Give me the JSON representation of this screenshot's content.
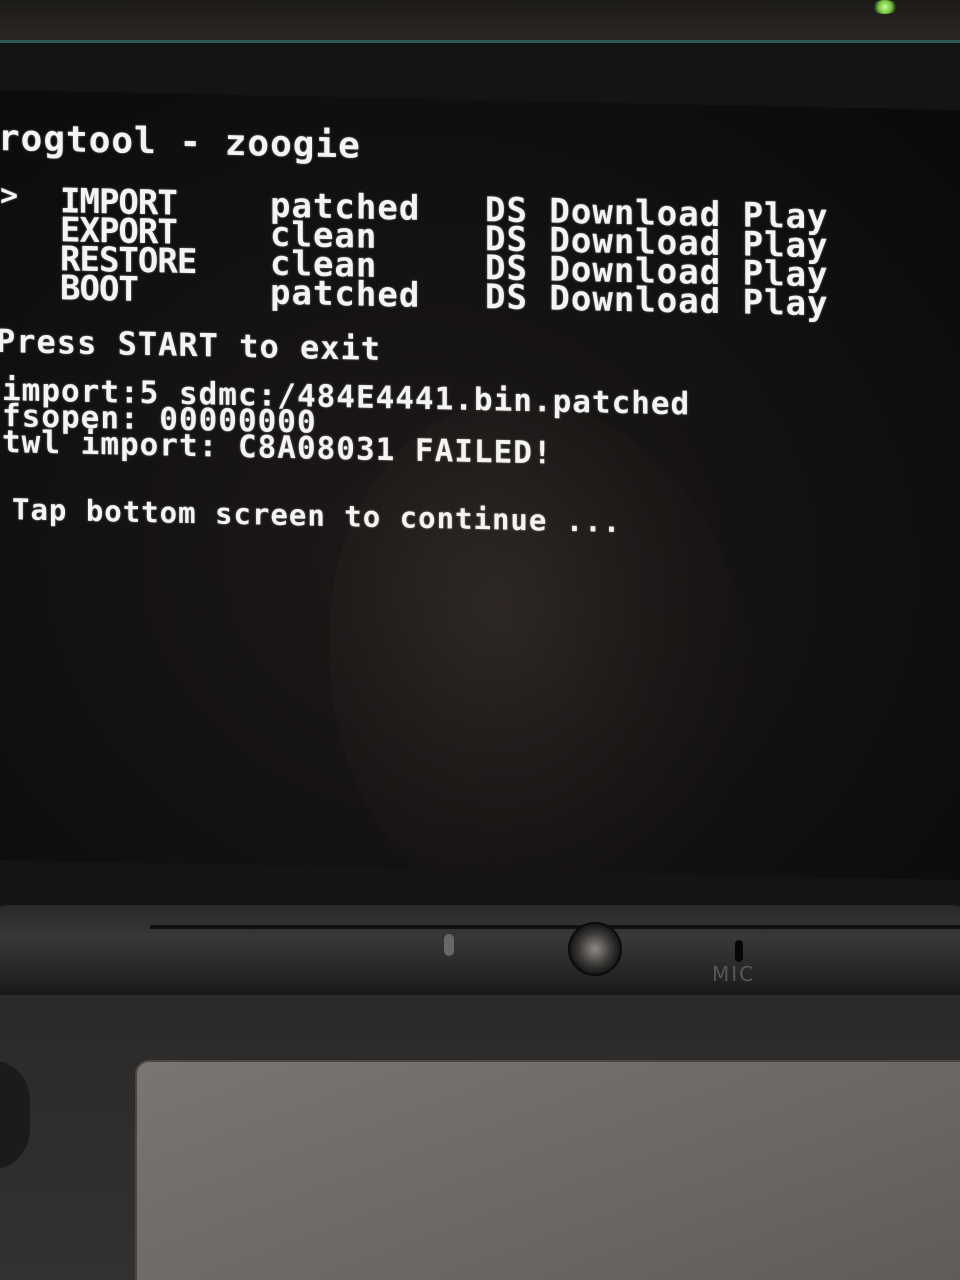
{
  "device": {
    "mic_label": "MIC"
  },
  "terminal": {
    "title": "rogtool - zoogie",
    "cursor": ">",
    "menu": [
      {
        "action": "IMPORT",
        "mode": "patched",
        "target": "DS Download Play"
      },
      {
        "action": "EXPORT",
        "mode": "clean",
        "target": "DS Download Play"
      },
      {
        "action": "RESTORE",
        "mode": "clean",
        "target": "DS Download Play"
      },
      {
        "action": "BOOT",
        "mode": "patched",
        "target": "DS Download Play"
      }
    ],
    "exit_hint": "Press START to exit",
    "log": [
      "import:5 sdmc:/484E4441.bin.patched",
      "fsopen: 00000000",
      "twl import: C8A08031 FAILED!"
    ],
    "continue_prompt": "Tap bottom screen to continue ..."
  },
  "colors": {
    "screen_background": "#121010",
    "text": "#f4f4f2",
    "shell_accent": "#2c5a5a"
  }
}
